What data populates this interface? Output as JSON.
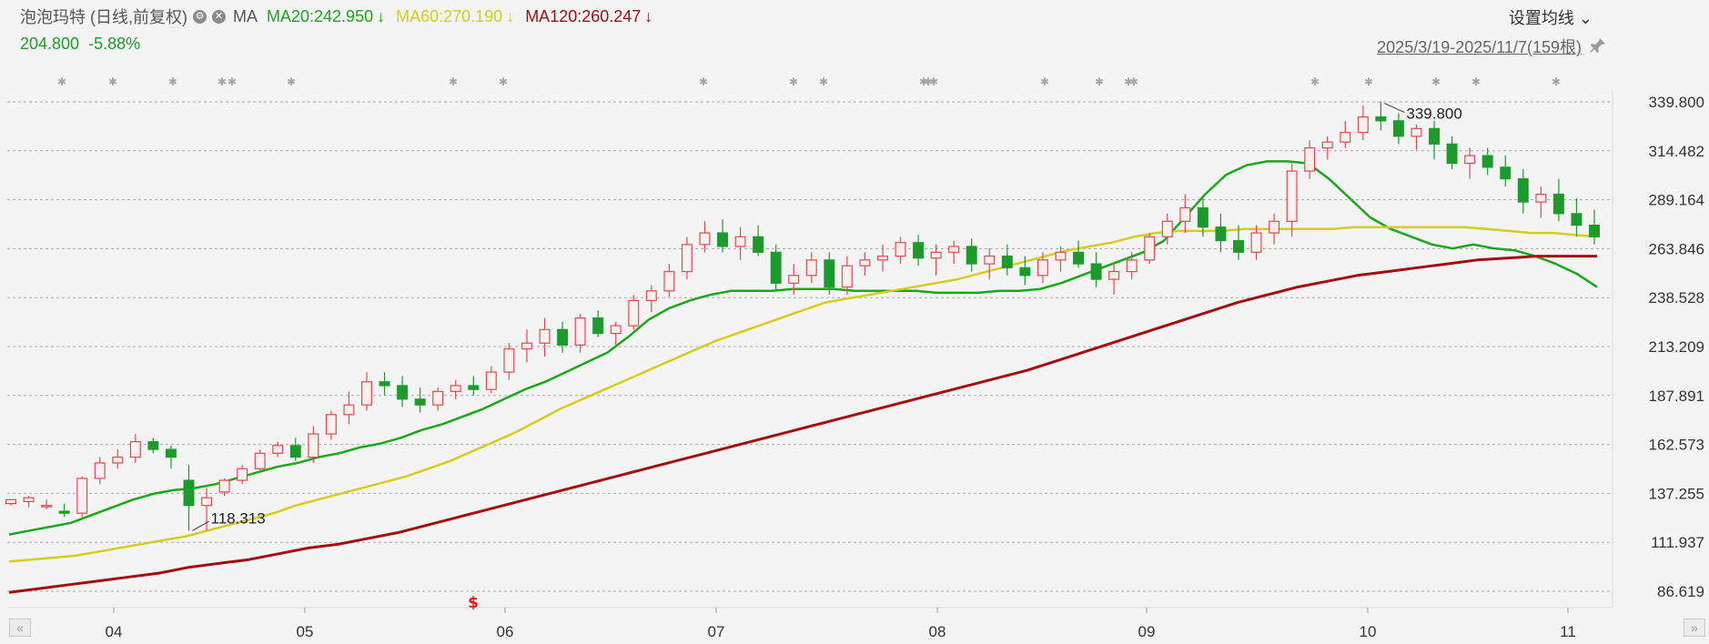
{
  "header": {
    "stock_name": "泡泡玛特 (日线,前复权)",
    "ma_label": "MA",
    "ma20": "MA20:242.950",
    "ma60": "MA60:270.190",
    "ma120": "MA120:260.247",
    "arrow": "↓",
    "last_price": "204.800",
    "change_pct": "-5.88%",
    "settings_label": "设置均线",
    "date_range": "2025/3/19-2025/11/7(159根)"
  },
  "colors": {
    "up": "#e8474b",
    "down": "#1c9b2c",
    "ma20": "#1aa81a",
    "ma60": "#d6cc1c",
    "ma120": "#a50e0e",
    "grid": "#a8a8a8",
    "text": "#333333"
  },
  "icons": [
    "gear-icon",
    "close-icon",
    "pin-icon",
    "scroll-left-icon",
    "scroll-right-icon"
  ],
  "chart_data": {
    "type": "candlestick",
    "title": "泡泡玛特 (日线,前复权)",
    "y_ticks": [
      "339.800",
      "314.482",
      "289.164",
      "263.846",
      "238.528",
      "213.209",
      "187.891",
      "162.573",
      "137.255",
      "111.937",
      "86.619"
    ],
    "ylim": [
      86.619,
      339.8
    ],
    "x_ticks": [
      "04",
      "05",
      "06",
      "07",
      "08",
      "09",
      "10",
      "11"
    ],
    "annotations": {
      "high": "339.800",
      "low": "118.313"
    },
    "dividend_marker": "$",
    "series": [
      {
        "name": "MA20",
        "values": [
          116,
          118,
          120,
          122,
          126,
          130,
          134,
          137,
          139,
          140,
          142,
          145,
          148,
          151,
          153,
          156,
          158,
          161,
          163,
          166,
          170,
          173,
          177,
          181,
          186,
          191,
          195,
          200,
          205,
          210,
          218,
          227,
          233,
          237,
          240,
          242,
          242,
          242,
          243,
          243,
          243,
          242,
          242,
          242,
          242,
          241,
          241,
          241,
          242,
          242,
          243,
          246,
          250,
          254,
          258,
          262,
          268,
          280,
          292,
          302,
          307,
          309,
          309,
          308,
          300,
          290,
          280,
          274,
          270,
          266,
          264,
          266,
          264,
          263,
          260,
          256,
          251,
          244
        ]
      },
      {
        "name": "MA60",
        "values": [
          102,
          103,
          104,
          105,
          107,
          109,
          111,
          113,
          115,
          118,
          121,
          124,
          127,
          131,
          134,
          137,
          140,
          143,
          146,
          150,
          154,
          159,
          164,
          169,
          175,
          181,
          186,
          191,
          196,
          201,
          206,
          211,
          216,
          220,
          224,
          228,
          232,
          236,
          238,
          240,
          242,
          244,
          246,
          248,
          251,
          254,
          257,
          260,
          263,
          265,
          267,
          270,
          272,
          273,
          273,
          273,
          274,
          274,
          274,
          274,
          274,
          275,
          275,
          275,
          275,
          275,
          275,
          274,
          273,
          272,
          272,
          271,
          270
        ]
      },
      {
        "name": "MA120",
        "values": [
          86,
          88,
          90,
          92,
          94,
          96,
          99,
          101,
          103,
          106,
          109,
          111,
          114,
          117,
          121,
          125,
          129,
          133,
          137,
          141,
          145,
          149,
          153,
          157,
          161,
          165,
          169,
          173,
          177,
          181,
          185,
          189,
          193,
          197,
          201,
          206,
          211,
          216,
          221,
          226,
          231,
          236,
          240,
          244,
          247,
          250,
          252,
          254,
          256,
          258,
          259,
          260,
          260,
          260
        ]
      }
    ],
    "candles": [
      [
        132,
        134,
        131,
        134
      ],
      [
        133,
        136,
        130,
        135
      ],
      [
        131,
        134,
        129,
        131
      ],
      [
        128,
        132,
        125,
        127
      ],
      [
        127,
        146,
        125,
        145
      ],
      [
        145,
        156,
        142,
        153
      ],
      [
        153,
        160,
        150,
        156
      ],
      [
        156,
        168,
        153,
        164
      ],
      [
        164,
        166,
        158,
        160
      ],
      [
        160,
        162,
        150,
        156
      ],
      [
        144,
        152,
        118,
        131
      ],
      [
        131,
        140,
        118,
        135
      ],
      [
        138,
        145,
        136,
        144
      ],
      [
        144,
        152,
        142,
        150
      ],
      [
        150,
        160,
        148,
        158
      ],
      [
        158,
        164,
        156,
        162
      ],
      [
        162,
        166,
        154,
        156
      ],
      [
        156,
        172,
        153,
        168
      ],
      [
        168,
        180,
        165,
        178
      ],
      [
        178,
        190,
        173,
        183
      ],
      [
        183,
        200,
        180,
        195
      ],
      [
        195,
        200,
        188,
        193
      ],
      [
        193,
        198,
        182,
        186
      ],
      [
        186,
        192,
        179,
        183
      ],
      [
        183,
        192,
        180,
        190
      ],
      [
        190,
        196,
        186,
        193
      ],
      [
        193,
        198,
        188,
        191
      ],
      [
        191,
        203,
        189,
        200
      ],
      [
        200,
        215,
        196,
        212
      ],
      [
        212,
        222,
        205,
        215
      ],
      [
        215,
        228,
        208,
        222
      ],
      [
        222,
        226,
        210,
        214
      ],
      [
        214,
        230,
        210,
        228
      ],
      [
        228,
        232,
        218,
        220
      ],
      [
        220,
        226,
        214,
        224
      ],
      [
        224,
        240,
        222,
        237
      ],
      [
        237,
        245,
        231,
        242
      ],
      [
        242,
        256,
        239,
        252
      ],
      [
        252,
        270,
        248,
        266
      ],
      [
        266,
        278,
        262,
        272
      ],
      [
        272,
        279,
        262,
        265
      ],
      [
        265,
        275,
        258,
        270
      ],
      [
        270,
        276,
        260,
        262
      ],
      [
        262,
        266,
        242,
        246
      ],
      [
        246,
        256,
        240,
        250
      ],
      [
        250,
        262,
        246,
        258
      ],
      [
        258,
        262,
        240,
        244
      ],
      [
        244,
        260,
        240,
        255
      ],
      [
        255,
        262,
        250,
        258
      ],
      [
        258,
        266,
        252,
        260
      ],
      [
        260,
        270,
        256,
        267
      ],
      [
        267,
        271,
        255,
        259
      ],
      [
        259,
        266,
        250,
        262
      ],
      [
        262,
        268,
        256,
        265
      ],
      [
        265,
        269,
        252,
        256
      ],
      [
        256,
        264,
        248,
        260
      ],
      [
        260,
        266,
        250,
        254
      ],
      [
        254,
        260,
        245,
        250
      ],
      [
        250,
        262,
        246,
        258
      ],
      [
        258,
        265,
        252,
        262
      ],
      [
        262,
        268,
        254,
        256
      ],
      [
        256,
        262,
        244,
        248
      ],
      [
        248,
        256,
        240,
        252
      ],
      [
        252,
        262,
        248,
        258
      ],
      [
        258,
        272,
        256,
        270
      ],
      [
        270,
        282,
        266,
        278
      ],
      [
        278,
        292,
        272,
        285
      ],
      [
        285,
        290,
        270,
        275
      ],
      [
        275,
        282,
        262,
        268
      ],
      [
        268,
        276,
        258,
        262
      ],
      [
        262,
        276,
        258,
        272
      ],
      [
        272,
        282,
        266,
        278
      ],
      [
        278,
        308,
        270,
        304
      ],
      [
        304,
        320,
        300,
        316
      ],
      [
        316,
        322,
        310,
        319
      ],
      [
        319,
        330,
        316,
        324
      ],
      [
        324,
        338,
        320,
        332
      ],
      [
        332,
        340,
        325,
        330
      ],
      [
        330,
        334,
        318,
        322
      ],
      [
        322,
        328,
        315,
        326
      ],
      [
        326,
        330,
        310,
        318
      ],
      [
        318,
        322,
        305,
        308
      ],
      [
        308,
        316,
        300,
        312
      ],
      [
        312,
        316,
        302,
        306
      ],
      [
        306,
        312,
        296,
        300
      ],
      [
        300,
        305,
        282,
        288
      ],
      [
        288,
        296,
        280,
        292
      ],
      [
        292,
        300,
        278,
        282
      ],
      [
        282,
        290,
        270,
        276
      ],
      [
        276,
        284,
        266,
        270
      ]
    ]
  }
}
